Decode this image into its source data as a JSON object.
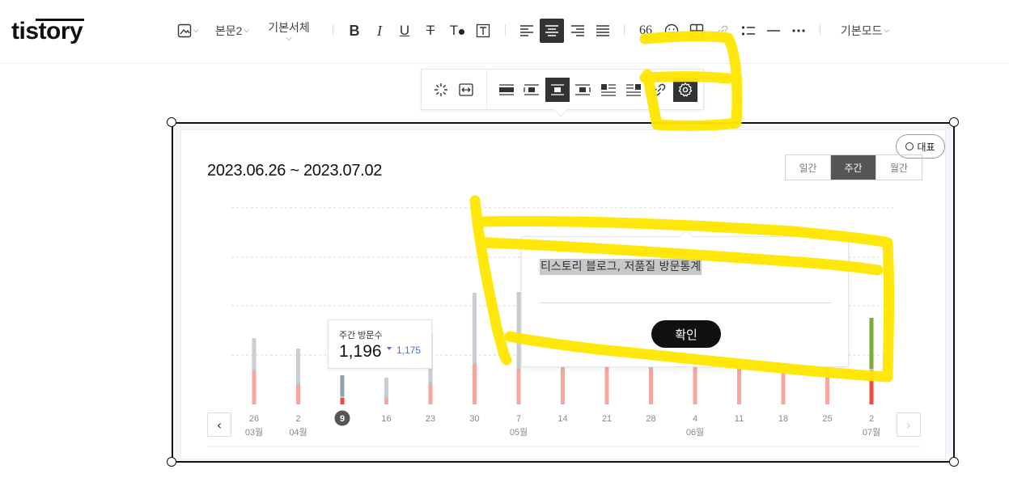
{
  "app": {
    "logo_text": "tistory"
  },
  "toolbar": {
    "paragraph_style": "본문2",
    "font_family": "기본서체",
    "quote_label": "66",
    "mode": "기본모드"
  },
  "image_toolbar": {
    "active": "settings"
  },
  "stats_image": {
    "date_range": "2023.06.26 ~ 2023.07.02",
    "representative_label": "대표",
    "periods": [
      "일간",
      "주간",
      "월간"
    ],
    "active_period": "주간",
    "tooltip": {
      "label": "주간 방문수",
      "value": "1,196",
      "compare": "1,175"
    },
    "selected_tick": "9"
  },
  "chart_data": {
    "type": "bar",
    "x_ticks": [
      "26",
      "2",
      "9",
      "16",
      "23",
      "30",
      "7",
      "14",
      "21",
      "28",
      "4",
      "11",
      "18",
      "25",
      "2"
    ],
    "month_labels": [
      {
        "tick_index": 0,
        "label": "03월"
      },
      {
        "tick_index": 1,
        "label": "04월"
      },
      {
        "tick_index": 6,
        "label": "05월"
      },
      {
        "tick_index": 10,
        "label": "06월"
      },
      {
        "tick_index": 14,
        "label": "07월"
      }
    ],
    "series": [
      {
        "values": [
          42,
          25,
          8,
          8,
          27,
          50,
          44,
          46,
          47,
          45,
          47,
          44,
          46,
          44,
          42
        ]
      },
      {
        "values": [
          40,
          44,
          28,
          25,
          62,
          88,
          95,
          60,
          65,
          63,
          66,
          64,
          62,
          60,
          65
        ]
      }
    ],
    "ylim": [
      0,
      250
    ],
    "grid": true,
    "colors": {
      "primary": "#f6a79f",
      "secondary": "#c9ced4",
      "highlight_primary": "#f24a3c",
      "highlight_secondary": "#8ea0b2",
      "last_primary": "#f24a3c",
      "last_secondary": "#7cab3a"
    }
  },
  "alt_popup": {
    "text": "티스토리 블로그, 저품질 방문통계",
    "confirm_label": "확인"
  },
  "annotations": {
    "highlight_color": "#ffe600"
  }
}
